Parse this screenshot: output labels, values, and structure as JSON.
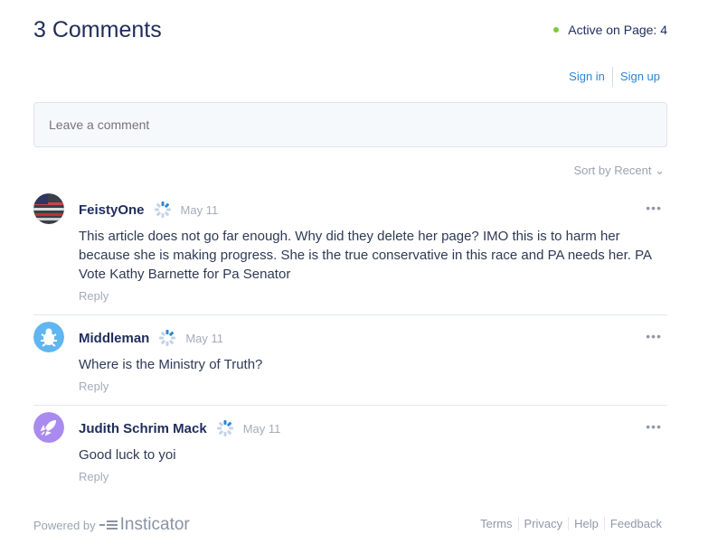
{
  "header": {
    "title": "3 Comments",
    "active_label": "Active on Page: 4"
  },
  "auth": {
    "sign_in": "Sign in",
    "sign_up": "Sign up"
  },
  "composer": {
    "placeholder": "Leave a comment"
  },
  "sort": {
    "label": "Sort by",
    "value": "Recent"
  },
  "comments": [
    {
      "author": "FeistyOne",
      "date": "May 11",
      "text": "This article does not go far enough. Why did they delete her page? IMO this is to harm her because she is making progress. She is the true conservative in this race and PA needs her. PA Vote Kathy Barnette for Pa Senator",
      "reply": "Reply",
      "menu": "•••"
    },
    {
      "author": "Middleman",
      "date": "May 11",
      "text": "Where is the Ministry of Truth?",
      "reply": "Reply",
      "menu": "•••"
    },
    {
      "author": "Judith Schrim Mack",
      "date": "May 11",
      "text": "Good luck to yoi",
      "reply": "Reply",
      "menu": "•••"
    }
  ],
  "footer": {
    "powered_by": "Powered by",
    "brand": "Insticator",
    "links": [
      "Terms",
      "Privacy",
      "Help",
      "Feedback"
    ]
  },
  "colors": {
    "accent": "#2a86d6",
    "active_dot": "#7ccb3a",
    "title": "#1f2d5c"
  }
}
